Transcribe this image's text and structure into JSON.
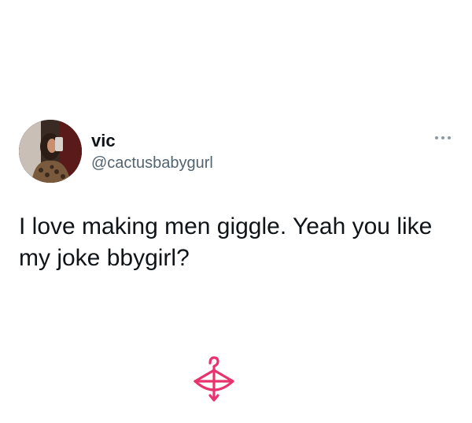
{
  "tweet": {
    "author": {
      "display_name": "vic",
      "handle": "@cactusbabygurl"
    },
    "text": "I love making men giggle. Yeah you like my joke bbygirl?",
    "more_icon": "more-dots-icon"
  },
  "watermark": {
    "icon": "hanger-bow-logo",
    "color": "#e8336f"
  }
}
